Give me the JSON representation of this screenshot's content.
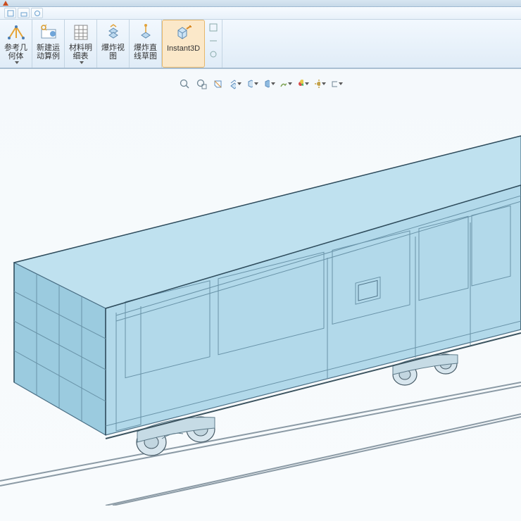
{
  "ribbon": {
    "buttons": [
      {
        "label": "参考几\n何体",
        "icon": "reference-geometry-icon"
      },
      {
        "label": "新建运\n动算例",
        "icon": "motion-study-icon"
      },
      {
        "label": "材料明\n细表",
        "icon": "bom-icon"
      },
      {
        "label": "爆炸视\n图",
        "icon": "exploded-view-icon"
      },
      {
        "label": "爆炸直\n线草图",
        "icon": "explode-sketch-icon"
      },
      {
        "label": "Instant3D",
        "icon": "instant3d-icon"
      }
    ]
  },
  "view_toolbar": {
    "items": [
      {
        "name": "zoom-fit-icon"
      },
      {
        "name": "zoom-area-icon"
      },
      {
        "name": "section-icon"
      },
      {
        "name": "view-select-icon"
      },
      {
        "name": "display-style-icon"
      },
      {
        "name": "render-icon"
      },
      {
        "name": "scene-icon"
      },
      {
        "name": "appearance-icon"
      },
      {
        "name": "settings-icon"
      },
      {
        "name": "camera-icon"
      }
    ]
  },
  "model": {
    "description": "3D freight railcar on parallel rails, isometric view"
  }
}
